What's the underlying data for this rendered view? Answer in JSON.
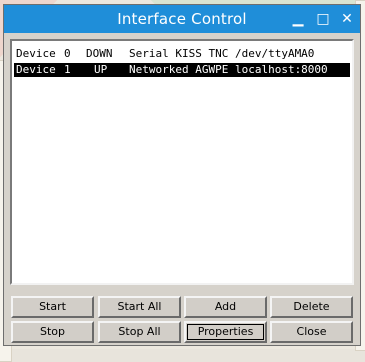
{
  "window": {
    "title": "Interface Control",
    "controls": {
      "minimize": "▁",
      "maximize": "□",
      "close": "✕"
    }
  },
  "devices": [
    {
      "label": "Device",
      "number": "0",
      "state": "DOWN",
      "description": "Serial KISS TNC /dev/ttyAMA0",
      "selected": false
    },
    {
      "label": "Device",
      "number": "1",
      "state": "UP",
      "description": "Networked AGWPE localhost:8000",
      "selected": true
    }
  ],
  "buttons": {
    "start": "Start",
    "start_all": "Start All",
    "add": "Add",
    "delete": "Delete",
    "stop": "Stop",
    "stop_all": "Stop All",
    "properties": "Properties",
    "close": "Close"
  },
  "colors": {
    "titlebar": "#1f8ed9",
    "selection": "#000000",
    "window_bg": "#d6d2cb"
  }
}
